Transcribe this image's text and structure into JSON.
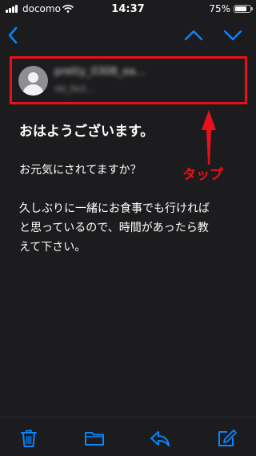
{
  "status_bar": {
    "carrier": "docomo",
    "time": "14:37",
    "battery_percent_label": "75%",
    "battery_level": 0.75
  },
  "nav": {
    "back_icon": "chevron-left-icon",
    "prev_icon": "chevron-up-icon",
    "next_icon": "chevron-down-icon"
  },
  "sender": {
    "name": "pretty_0308_ea...",
    "address": "dd_0e1..."
  },
  "annotation": {
    "label": "タップ",
    "color": "#e8101a"
  },
  "message": {
    "subject": "おはようございます。",
    "greeting": "お元気にされてますか？",
    "body_lines": [
      "久しぶりに一緒にお食事でも行ければ",
      "と思っているので、時間があったら教",
      "えて下さい。"
    ]
  },
  "toolbar": {
    "items": [
      "trash-icon",
      "folder-icon",
      "reply-icon",
      "compose-icon"
    ]
  },
  "colors": {
    "accent": "#0a84ff",
    "background": "#1c1c1e",
    "highlight": "#e8101a"
  }
}
